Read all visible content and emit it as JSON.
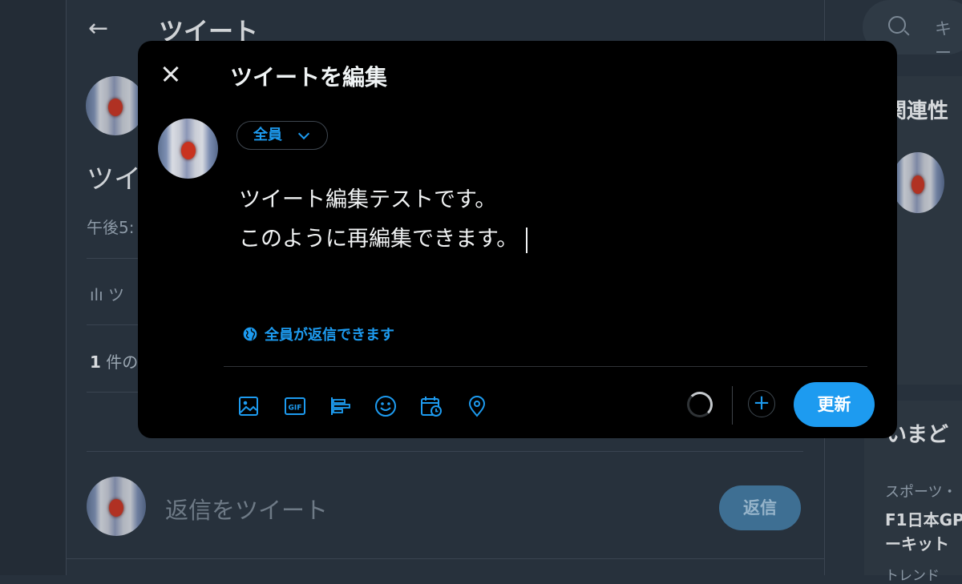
{
  "background": {
    "header_title": "ツイート",
    "tweet_text_partial": "ツイ",
    "time_partial": "午後5:",
    "analytics_partial": "ツ",
    "count_number": "1",
    "count_partial": "件の",
    "reply_placeholder": "返信をツイート",
    "reply_button": "返信"
  },
  "right": {
    "search_placeholder": "キー",
    "related_title": "関連性",
    "trends_title": "いまど",
    "trend_category": "スポーツ・",
    "trend_name": "F1日本GP\nーキット",
    "trend_sub": "トレンド"
  },
  "modal": {
    "title": "ツイートを編集",
    "audience": "全員",
    "text_line1": "ツイート編集テストです。",
    "text_line2": "このように再編集できます。",
    "reply_setting": "全員が返信できます",
    "update_button": "更新",
    "add_button": "+",
    "toolbar_icons": [
      "media-icon",
      "gif-icon",
      "poll-icon",
      "emoji-icon",
      "schedule-icon",
      "location-icon"
    ]
  },
  "colors": {
    "accent": "#1d9bf0",
    "modal_bg": "#000000",
    "page_bg": "#27313c"
  }
}
